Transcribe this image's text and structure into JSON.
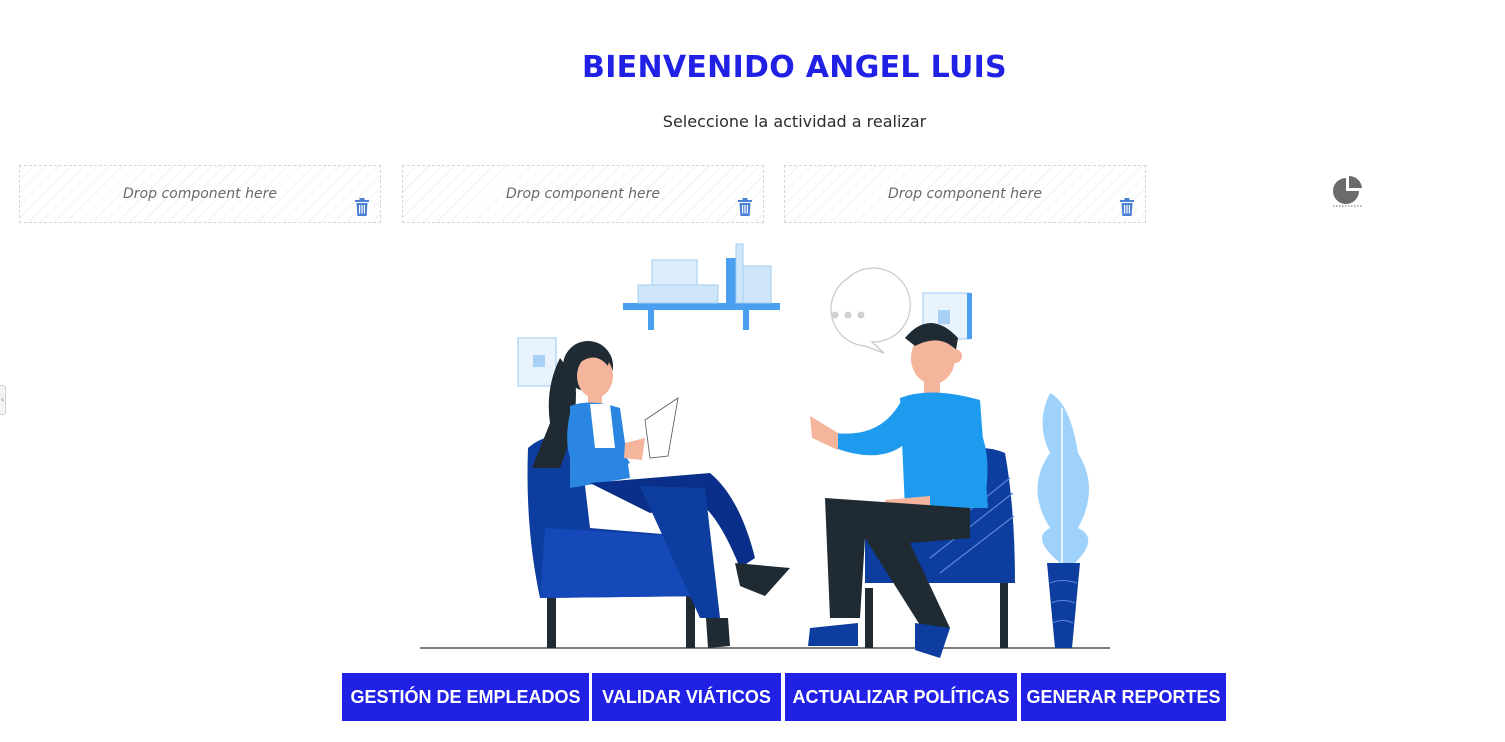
{
  "header": {
    "title": "BIENVENIDO ANGEL LUIS",
    "subtitle": "Seleccione la actividad a realizar"
  },
  "drop_zones": [
    {
      "label": "Drop component here",
      "delete_icon": "trash-icon"
    },
    {
      "label": "Drop component here",
      "delete_icon": "trash-icon"
    },
    {
      "label": "Drop component here",
      "delete_icon": "trash-icon"
    }
  ],
  "widgets": {
    "chart_icon": "pie-chart-icon"
  },
  "side_tab": {
    "label": "‹"
  },
  "illustration": {
    "subject": "two people talking in armchairs"
  },
  "actions": [
    {
      "label": "GESTIÓN DE EMPLEADOS"
    },
    {
      "label": "VALIDAR VIÁTICOS"
    },
    {
      "label": "ACTUALIZAR POLÍTICAS"
    },
    {
      "label": "GENERAR REPORTES"
    }
  ],
  "colors": {
    "primary": "#2121e6",
    "drop_border": "#d6d6d6",
    "trash_icon": "#4a7fd6",
    "illustration_dark_blue": "#0d3d9e",
    "illustration_light_blue": "#1e9bef"
  }
}
